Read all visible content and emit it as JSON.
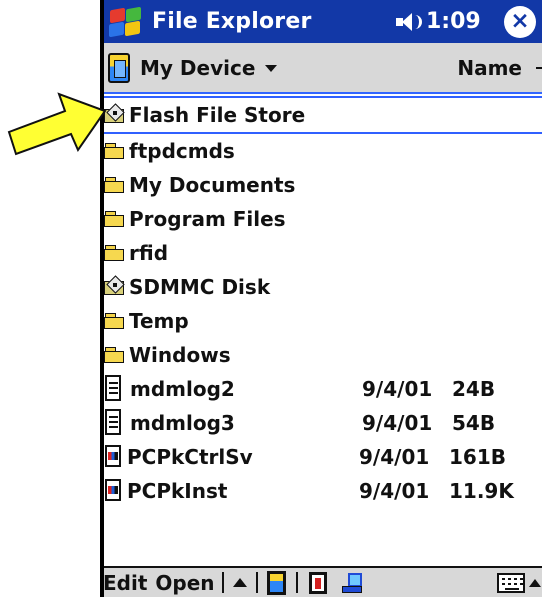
{
  "window": {
    "title": "File Explorer",
    "time": "1:09",
    "close_symbol": "×"
  },
  "location": {
    "current": "My Device",
    "sort_by": "Name"
  },
  "files": [
    {
      "name": "Flash File Store",
      "date": "",
      "size": "",
      "icon": "storage-card-icon",
      "selected": true
    },
    {
      "name": "ftpdcmds",
      "date": "",
      "size": "",
      "icon": "folder-icon"
    },
    {
      "name": "My Documents",
      "date": "",
      "size": "",
      "icon": "folder-icon"
    },
    {
      "name": "Program Files",
      "date": "",
      "size": "",
      "icon": "folder-icon"
    },
    {
      "name": "rfid",
      "date": "",
      "size": "",
      "icon": "folder-icon"
    },
    {
      "name": "SDMMC Disk",
      "date": "",
      "size": "",
      "icon": "storage-card-icon"
    },
    {
      "name": "Temp",
      "date": "",
      "size": "",
      "icon": "folder-icon"
    },
    {
      "name": "Windows",
      "date": "",
      "size": "",
      "icon": "folder-icon"
    },
    {
      "name": "mdmlog2",
      "date": "9/4/01",
      "size": "24B",
      "icon": "document-icon"
    },
    {
      "name": "mdmlog3",
      "date": "9/4/01",
      "size": "54B",
      "icon": "document-icon"
    },
    {
      "name": "PCPkCtrlSv",
      "date": "9/4/01",
      "size": "161B",
      "icon": "program-icon"
    },
    {
      "name": "PCPkInst",
      "date": "9/4/01",
      "size": "11.9K",
      "icon": "program-icon"
    }
  ],
  "bottom_bar": {
    "edit": "Edit",
    "open": "Open"
  },
  "icons": {
    "title_logo": "windows-logo-icon",
    "volume": "speaker-icon",
    "location": "device-icon",
    "up": "up-arrow-icon",
    "device_button": "device-button-icon",
    "storage_button": "storage-card-button-icon",
    "network_button": "network-button-icon",
    "keyboard": "keyboard-icon",
    "callout": "yellow-arrow-icon"
  },
  "colors": {
    "title_bar": "#1238a7",
    "toolbar": "#d8d8d8",
    "selection_border": "#3060ff",
    "callout_arrow": "#ffff33"
  }
}
